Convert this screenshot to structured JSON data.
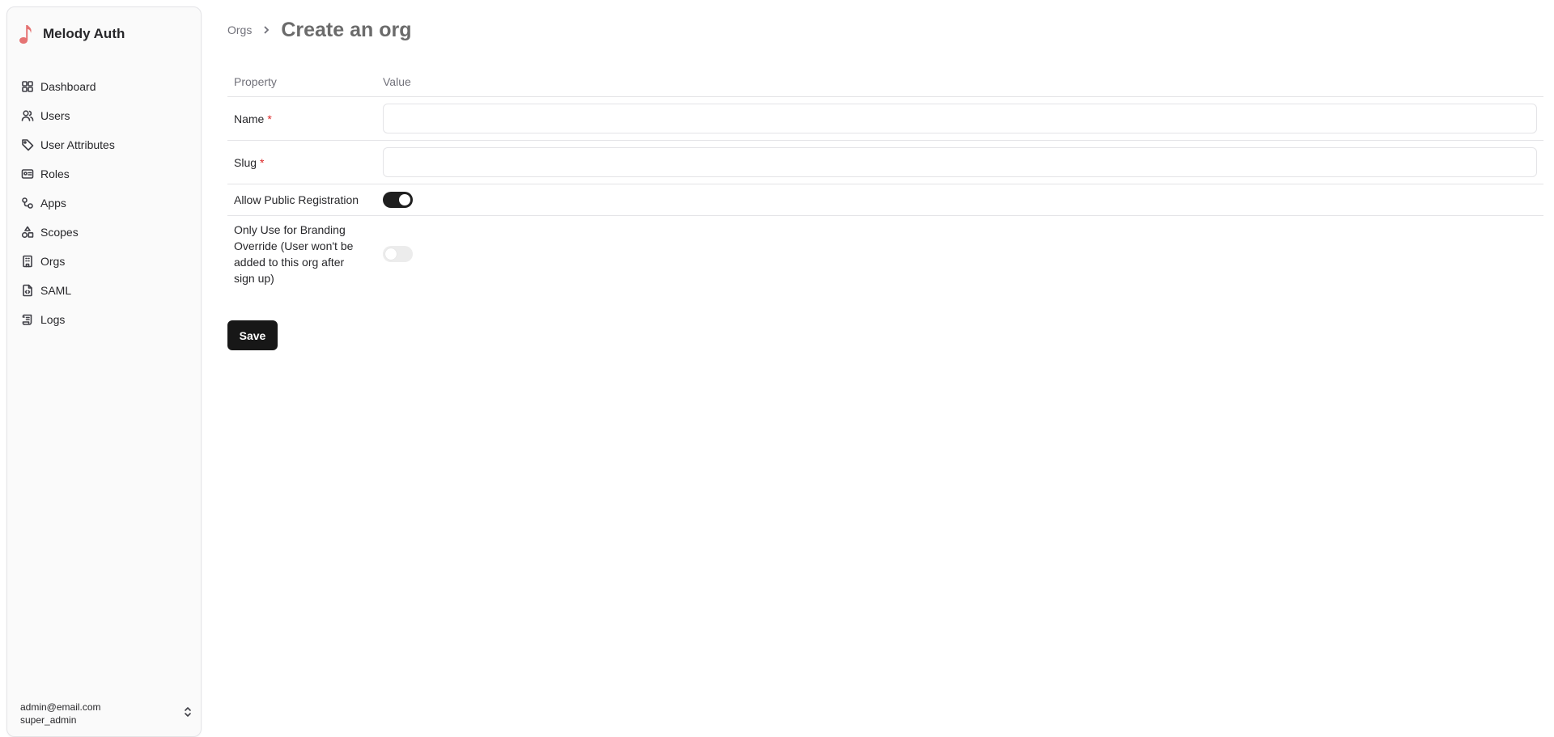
{
  "app": {
    "name": "Melody Auth",
    "logo_icon": "music-note-icon",
    "logo_color": "#e57373"
  },
  "sidebar": {
    "items": [
      {
        "label": "Dashboard",
        "icon": "dashboard-icon"
      },
      {
        "label": "Users",
        "icon": "users-icon"
      },
      {
        "label": "User Attributes",
        "icon": "tag-icon"
      },
      {
        "label": "Roles",
        "icon": "id-card-icon"
      },
      {
        "label": "Apps",
        "icon": "apps-icon"
      },
      {
        "label": "Scopes",
        "icon": "shapes-icon"
      },
      {
        "label": "Orgs",
        "icon": "building-icon"
      },
      {
        "label": "SAML",
        "icon": "file-code-icon"
      },
      {
        "label": "Logs",
        "icon": "scroll-icon"
      }
    ],
    "account": {
      "email": "admin@email.com",
      "role": "super_admin",
      "icon": "chevrons-up-down-icon"
    }
  },
  "breadcrumb": {
    "parent": "Orgs",
    "title": "Create an org"
  },
  "form": {
    "header": {
      "property": "Property",
      "value": "Value"
    },
    "name": {
      "label": "Name",
      "required": "*",
      "value": ""
    },
    "slug": {
      "label": "Slug",
      "required": "*",
      "value": ""
    },
    "allow_public_registration": {
      "label": "Allow Public Registration",
      "enabled": true
    },
    "branding_override": {
      "label": "Only Use for Branding Override (User won't be added to this org after sign up)",
      "enabled": false
    },
    "save_label": "Save"
  },
  "colors": {
    "primary": "#171717",
    "required": "#dc2626",
    "border": "#e4e4e7",
    "muted": "#71717a"
  }
}
